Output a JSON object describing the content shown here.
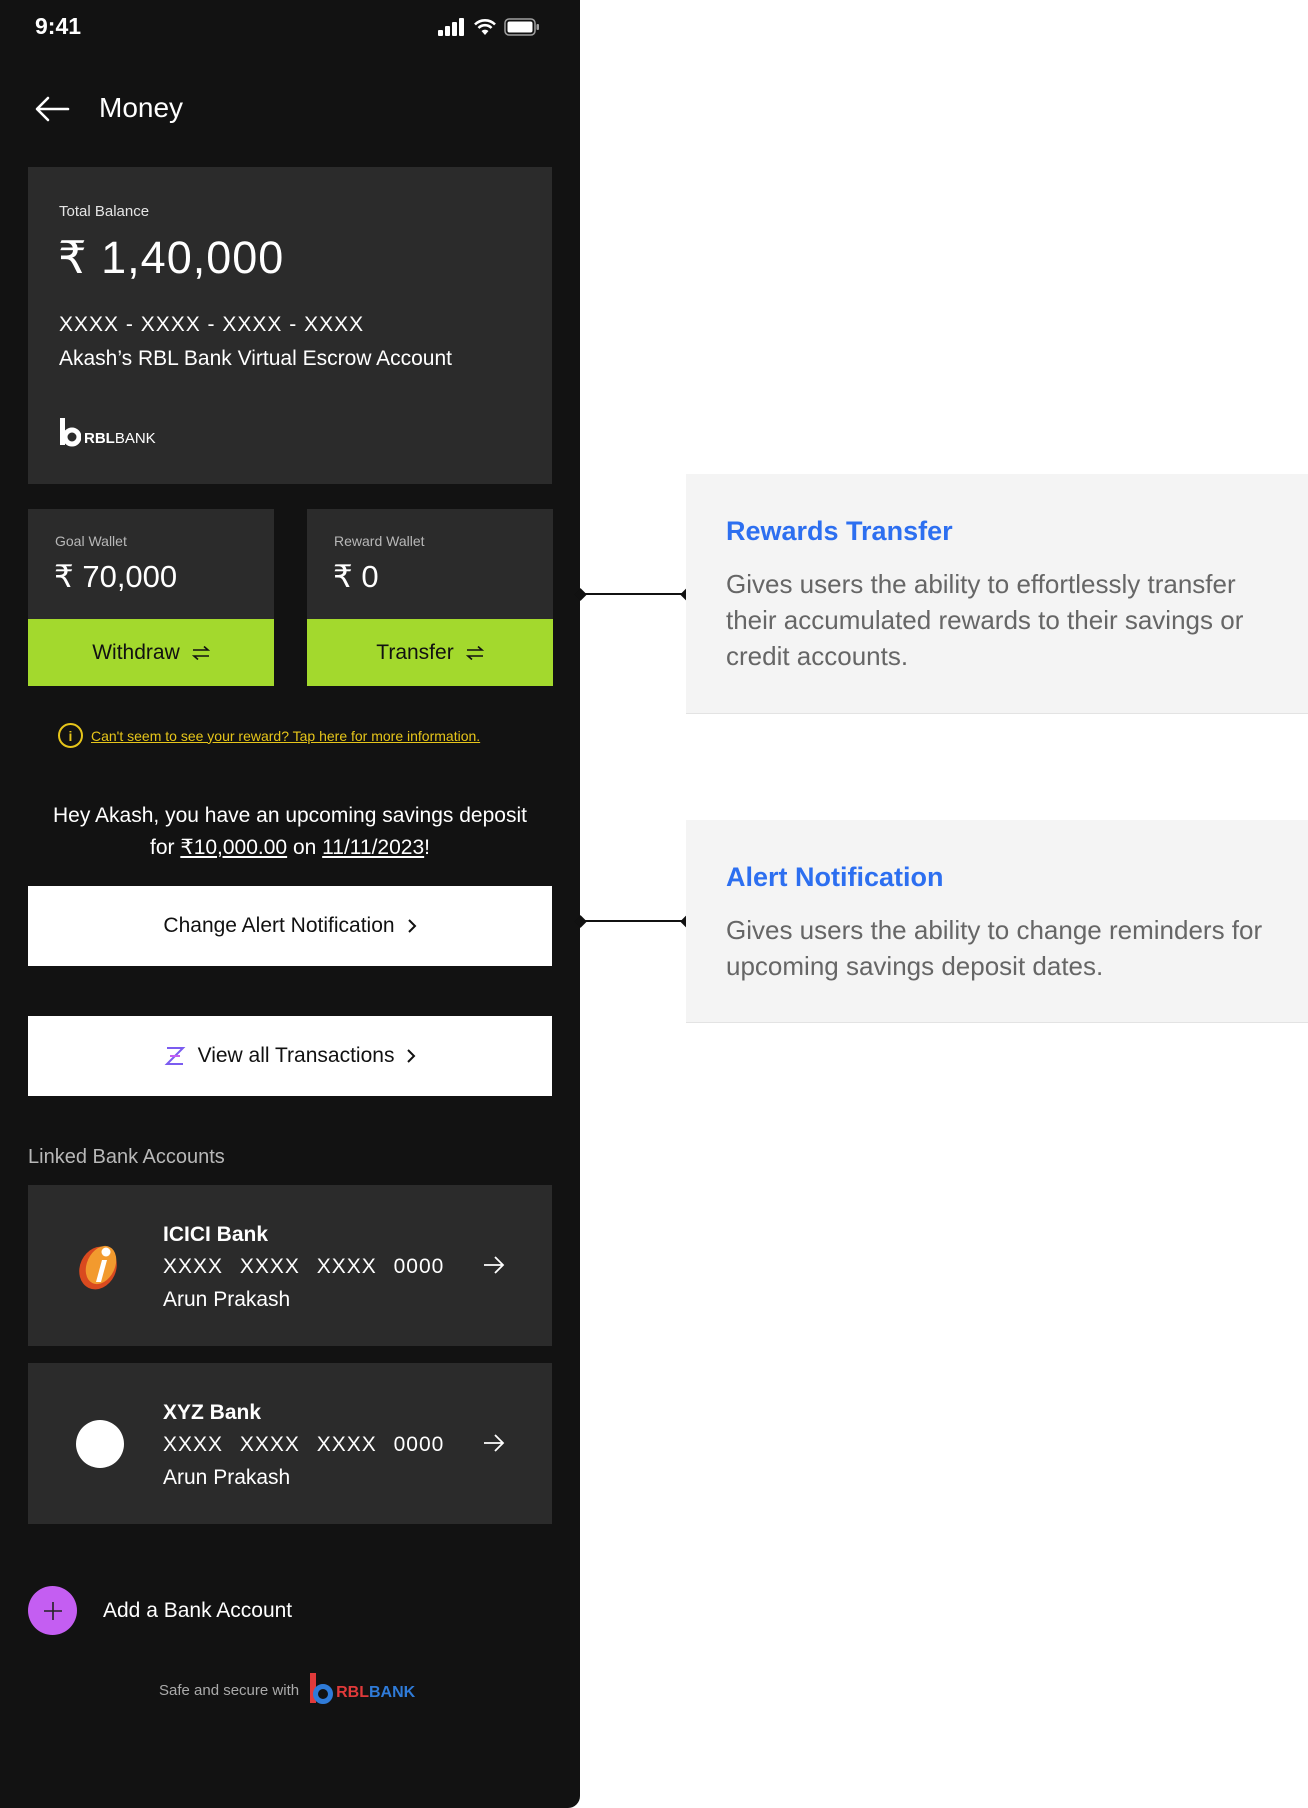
{
  "status_bar": {
    "time": "9:41"
  },
  "header": {
    "title": "Money"
  },
  "balance": {
    "label": "Total Balance",
    "amount": "₹ 1,40,000",
    "account_mask": "XXXX - XXXX - XXXX - XXXX",
    "account_name": "Akash’s RBL Bank Virtual Escrow Account",
    "logo_text_bold": "RBL",
    "logo_text_rest": "BANK"
  },
  "wallets": {
    "goal": {
      "label": "Goal Wallet",
      "amount": "₹ 70,000",
      "button_label": "Withdraw"
    },
    "reward": {
      "label": "Reward Wallet",
      "amount": "₹ 0",
      "button_label": "Transfer"
    }
  },
  "info_link": "Can't seem to see your reward? Tap here for more information.",
  "upcoming": {
    "line1": "Hey Akash, you have an upcoming savings deposit",
    "for_text": "for ",
    "amount": "₹10,000.00",
    "on_text": " on ",
    "date": "11/11/2023",
    "suffix": "!"
  },
  "alert_button": "Change Alert Notification",
  "transactions_button": "View all Transactions",
  "linked_accounts": {
    "label": "Linked Bank Accounts",
    "banks": [
      {
        "name": "ICICI Bank",
        "number": "XXXX XXXX XXXX 0000",
        "holder": "Arun Prakash"
      },
      {
        "name": "XYZ Bank",
        "number": "XXXX XXXX XXXX 0000",
        "holder": "Arun Prakash"
      }
    ]
  },
  "add_bank": "Add a Bank Account",
  "secure": {
    "text": "Safe and secure with",
    "logo_bold": "RBL",
    "logo_rest": "BANK"
  },
  "annotations": {
    "rewards": {
      "title": "Rewards Transfer",
      "description": "Gives users the ability to effortlessly transfer their accumulated rewards to their savings or credit accounts."
    },
    "alert": {
      "title": "Alert Notification",
      "description": "Gives users the ability to change reminders for upcoming savings deposit dates."
    }
  },
  "colors": {
    "accent_green": "#a3d92d",
    "annotation_blue": "#2d6ff0",
    "info_yellow": "#e6c51a",
    "add_purple": "#c45ef2"
  }
}
